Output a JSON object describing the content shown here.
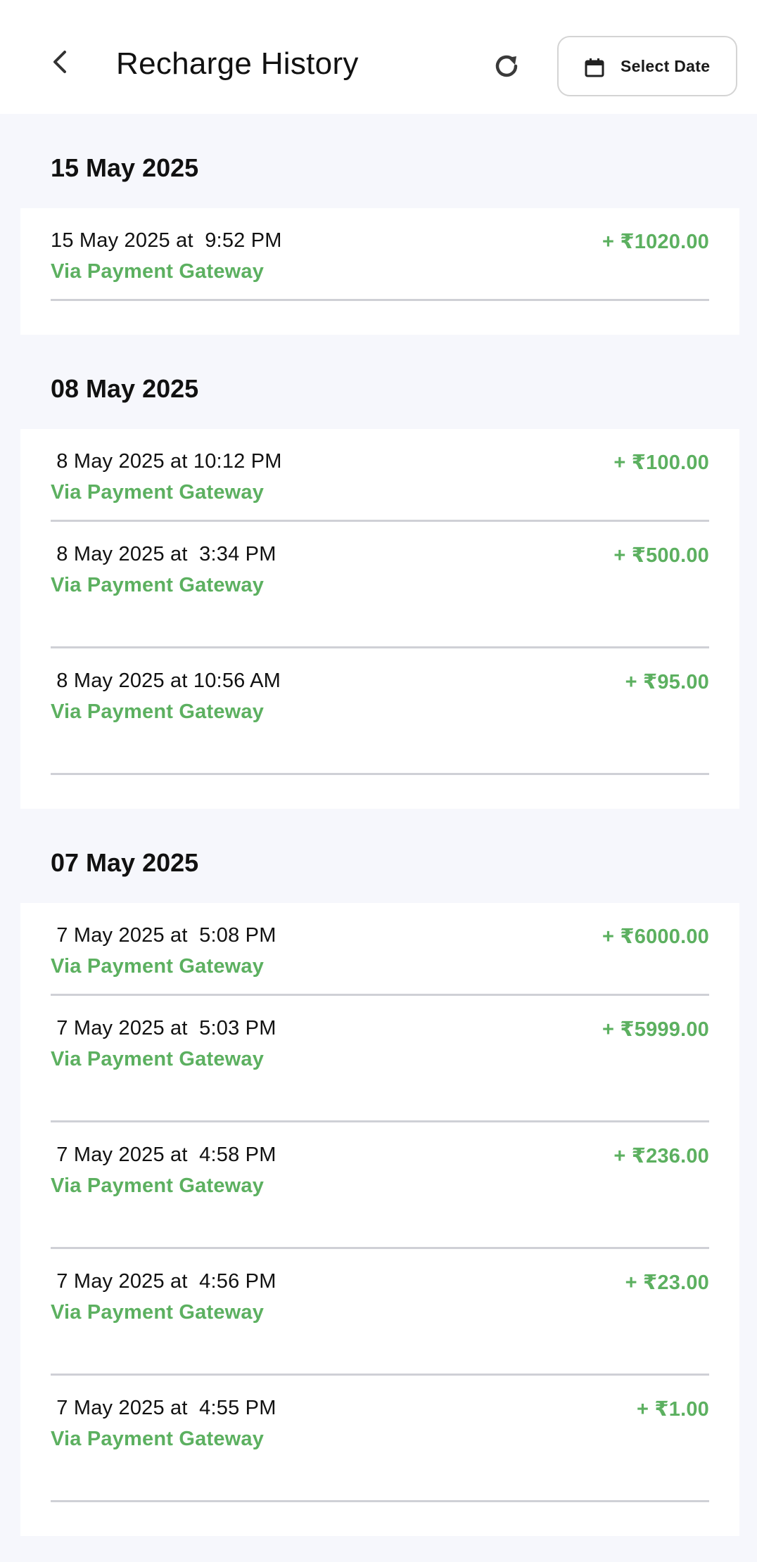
{
  "header": {
    "title": "Recharge History",
    "select_date_label": "Select Date"
  },
  "colors": {
    "accent_green": "#5cb060",
    "background": "#f6f7fc",
    "divider": "#cfd0d6"
  },
  "groups": [
    {
      "date": "15 May 2025",
      "items": [
        {
          "time": "15 May 2025 at  9:52 PM",
          "via": "Via Payment Gateway",
          "amount": "+ ₹1020.00"
        }
      ]
    },
    {
      "date": "08 May 2025",
      "items": [
        {
          "time": " 8 May 2025 at 10:12 PM",
          "via": "Via Payment Gateway",
          "amount": "+ ₹100.00"
        },
        {
          "time": " 8 May 2025 at  3:34 PM",
          "via": "Via Payment Gateway",
          "amount": "+ ₹500.00"
        },
        {
          "time": " 8 May 2025 at 10:56 AM",
          "via": "Via Payment Gateway",
          "amount": "+ ₹95.00"
        }
      ]
    },
    {
      "date": "07 May 2025",
      "items": [
        {
          "time": " 7 May 2025 at  5:08 PM",
          "via": "Via Payment Gateway",
          "amount": "+ ₹6000.00"
        },
        {
          "time": " 7 May 2025 at  5:03 PM",
          "via": "Via Payment Gateway",
          "amount": "+ ₹5999.00"
        },
        {
          "time": " 7 May 2025 at  4:58 PM",
          "via": "Via Payment Gateway",
          "amount": "+ ₹236.00"
        },
        {
          "time": " 7 May 2025 at  4:56 PM",
          "via": "Via Payment Gateway",
          "amount": "+ ₹23.00"
        },
        {
          "time": " 7 May 2025 at  4:55 PM",
          "via": "Via Payment Gateway",
          "amount": "+ ₹1.00"
        }
      ]
    }
  ]
}
